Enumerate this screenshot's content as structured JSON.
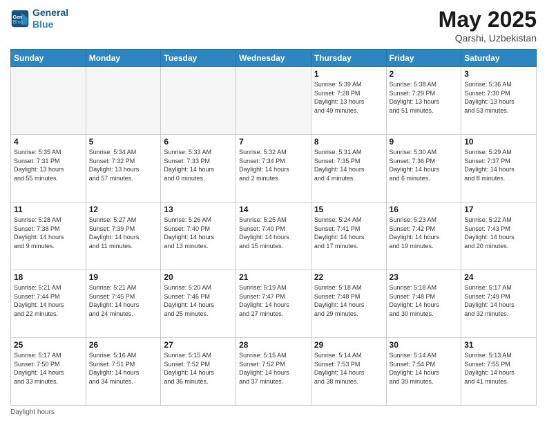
{
  "logo": {
    "line1": "General",
    "line2": "Blue"
  },
  "title": {
    "month_year": "May 2025",
    "location": "Qarshi, Uzbekistan"
  },
  "weekdays": [
    "Sunday",
    "Monday",
    "Tuesday",
    "Wednesday",
    "Thursday",
    "Friday",
    "Saturday"
  ],
  "weeks": [
    [
      {
        "day": "",
        "info": ""
      },
      {
        "day": "",
        "info": ""
      },
      {
        "day": "",
        "info": ""
      },
      {
        "day": "",
        "info": ""
      },
      {
        "day": "1",
        "info": "Sunrise: 5:39 AM\nSunset: 7:28 PM\nDaylight: 13 hours\nand 49 minutes."
      },
      {
        "day": "2",
        "info": "Sunrise: 5:38 AM\nSunset: 7:29 PM\nDaylight: 13 hours\nand 51 minutes."
      },
      {
        "day": "3",
        "info": "Sunrise: 5:36 AM\nSunset: 7:30 PM\nDaylight: 13 hours\nand 53 minutes."
      }
    ],
    [
      {
        "day": "4",
        "info": "Sunrise: 5:35 AM\nSunset: 7:31 PM\nDaylight: 13 hours\nand 55 minutes."
      },
      {
        "day": "5",
        "info": "Sunrise: 5:34 AM\nSunset: 7:32 PM\nDaylight: 13 hours\nand 57 minutes."
      },
      {
        "day": "6",
        "info": "Sunrise: 5:33 AM\nSunset: 7:33 PM\nDaylight: 14 hours\nand 0 minutes."
      },
      {
        "day": "7",
        "info": "Sunrise: 5:32 AM\nSunset: 7:34 PM\nDaylight: 14 hours\nand 2 minutes."
      },
      {
        "day": "8",
        "info": "Sunrise: 5:31 AM\nSunset: 7:35 PM\nDaylight: 14 hours\nand 4 minutes."
      },
      {
        "day": "9",
        "info": "Sunrise: 5:30 AM\nSunset: 7:36 PM\nDaylight: 14 hours\nand 6 minutes."
      },
      {
        "day": "10",
        "info": "Sunrise: 5:29 AM\nSunset: 7:37 PM\nDaylight: 14 hours\nand 8 minutes."
      }
    ],
    [
      {
        "day": "11",
        "info": "Sunrise: 5:28 AM\nSunset: 7:38 PM\nDaylight: 14 hours\nand 9 minutes."
      },
      {
        "day": "12",
        "info": "Sunrise: 5:27 AM\nSunset: 7:39 PM\nDaylight: 14 hours\nand 11 minutes."
      },
      {
        "day": "13",
        "info": "Sunrise: 5:26 AM\nSunset: 7:40 PM\nDaylight: 14 hours\nand 13 minutes."
      },
      {
        "day": "14",
        "info": "Sunrise: 5:25 AM\nSunset: 7:40 PM\nDaylight: 14 hours\nand 15 minutes."
      },
      {
        "day": "15",
        "info": "Sunrise: 5:24 AM\nSunset: 7:41 PM\nDaylight: 14 hours\nand 17 minutes."
      },
      {
        "day": "16",
        "info": "Sunrise: 5:23 AM\nSunset: 7:42 PM\nDaylight: 14 hours\nand 19 minutes."
      },
      {
        "day": "17",
        "info": "Sunrise: 5:22 AM\nSunset: 7:43 PM\nDaylight: 14 hours\nand 20 minutes."
      }
    ],
    [
      {
        "day": "18",
        "info": "Sunrise: 5:21 AM\nSunset: 7:44 PM\nDaylight: 14 hours\nand 22 minutes."
      },
      {
        "day": "19",
        "info": "Sunrise: 5:21 AM\nSunset: 7:45 PM\nDaylight: 14 hours\nand 24 minutes."
      },
      {
        "day": "20",
        "info": "Sunrise: 5:20 AM\nSunset: 7:46 PM\nDaylight: 14 hours\nand 25 minutes."
      },
      {
        "day": "21",
        "info": "Sunrise: 5:19 AM\nSunset: 7:47 PM\nDaylight: 14 hours\nand 27 minutes."
      },
      {
        "day": "22",
        "info": "Sunrise: 5:18 AM\nSunset: 7:48 PM\nDaylight: 14 hours\nand 29 minutes."
      },
      {
        "day": "23",
        "info": "Sunrise: 5:18 AM\nSunset: 7:48 PM\nDaylight: 14 hours\nand 30 minutes."
      },
      {
        "day": "24",
        "info": "Sunrise: 5:17 AM\nSunset: 7:49 PM\nDaylight: 14 hours\nand 32 minutes."
      }
    ],
    [
      {
        "day": "25",
        "info": "Sunrise: 5:17 AM\nSunset: 7:50 PM\nDaylight: 14 hours\nand 33 minutes."
      },
      {
        "day": "26",
        "info": "Sunrise: 5:16 AM\nSunset: 7:51 PM\nDaylight: 14 hours\nand 34 minutes."
      },
      {
        "day": "27",
        "info": "Sunrise: 5:15 AM\nSunset: 7:52 PM\nDaylight: 14 hours\nand 36 minutes."
      },
      {
        "day": "28",
        "info": "Sunrise: 5:15 AM\nSunset: 7:52 PM\nDaylight: 14 hours\nand 37 minutes."
      },
      {
        "day": "29",
        "info": "Sunrise: 5:14 AM\nSunset: 7:53 PM\nDaylight: 14 hours\nand 38 minutes."
      },
      {
        "day": "30",
        "info": "Sunrise: 5:14 AM\nSunset: 7:54 PM\nDaylight: 14 hours\nand 39 minutes."
      },
      {
        "day": "31",
        "info": "Sunrise: 5:13 AM\nSunset: 7:55 PM\nDaylight: 14 hours\nand 41 minutes."
      }
    ]
  ],
  "footer": {
    "note": "Daylight hours"
  }
}
